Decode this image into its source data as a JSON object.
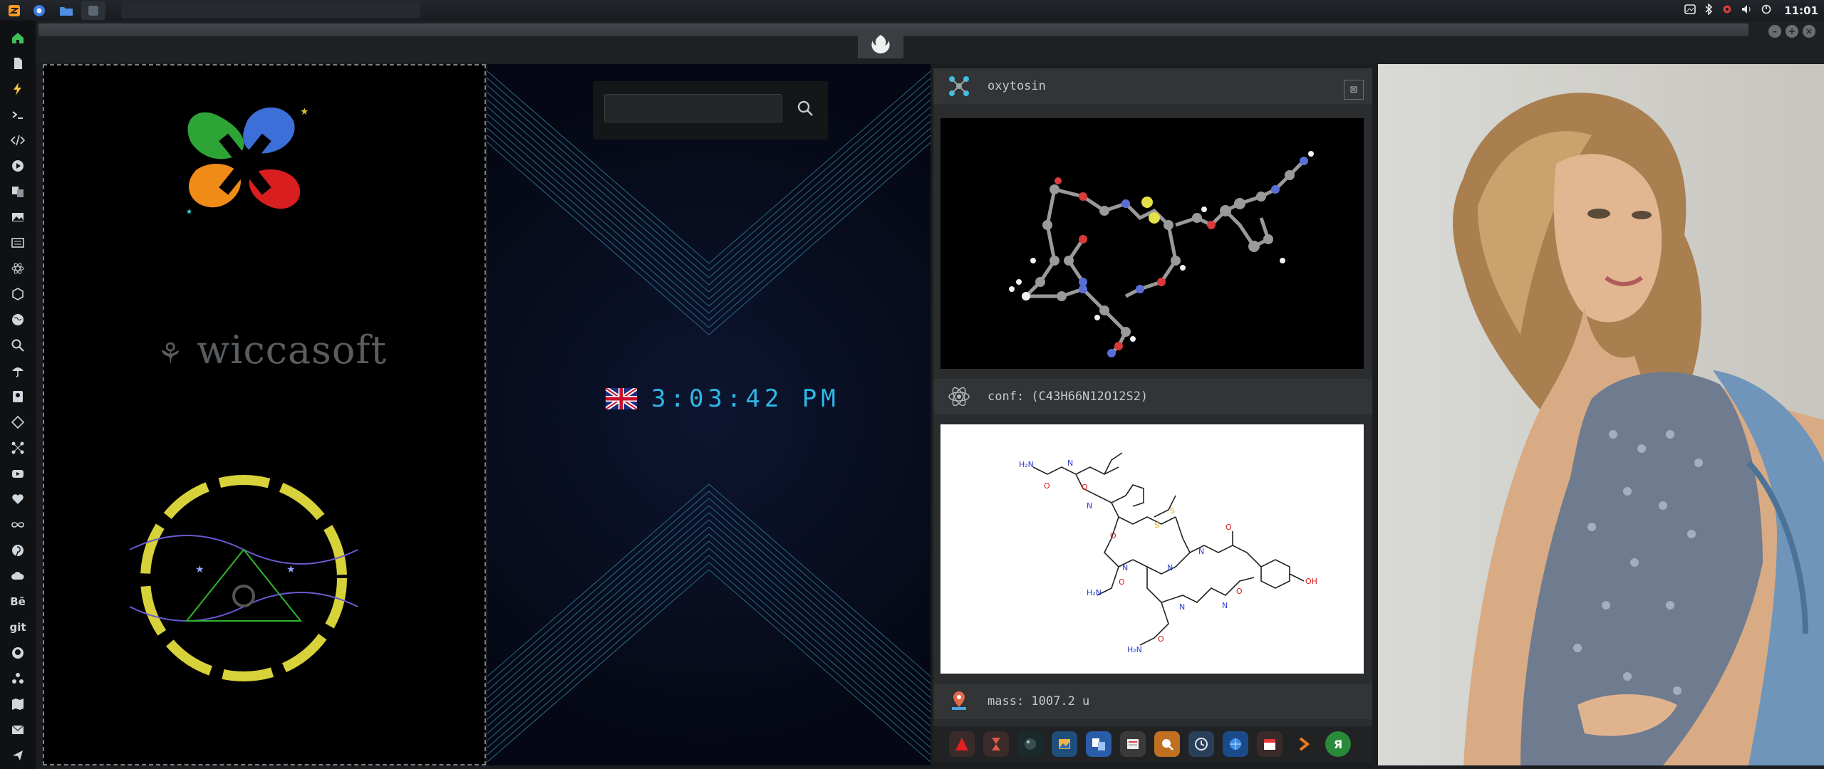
{
  "topbar": {
    "clock": "11:01",
    "tray_icons": [
      "image-icon",
      "bluetooth-icon",
      "gear-icon",
      "volume-icon",
      "power-icon"
    ]
  },
  "dock": {
    "icons": [
      "home-icon",
      "document-icon",
      "lightning-icon",
      "terminal-icon",
      "code-icon",
      "play-icon",
      "translate-icon",
      "image-icon",
      "news-icon",
      "react-icon",
      "hexagon-icon",
      "globe-icon",
      "search-icon",
      "umbrella-icon",
      "contacts-icon",
      "tag-icon",
      "network-icon",
      "youtube-icon",
      "heart-icon",
      "infinity-icon",
      "pinterest-icon",
      "cloud-icon",
      "behance-icon",
      "git-icon",
      "github-icon",
      "puzzle-icon",
      "map-icon",
      "mail-icon",
      "share-icon"
    ],
    "behance_label": "Bē",
    "git_label": "git"
  },
  "panel1": {
    "brand": "wiccasoft"
  },
  "panel2": {
    "search": {
      "placeholder": "",
      "value": ""
    },
    "time": "3:03:42 PM"
  },
  "panel3": {
    "molecule_name": "oxytosin",
    "conformation": "conf: (C43H66N12O12S2)",
    "mass": "mass: 1007.2 u",
    "colors": {
      "carbon": "#9a9a9a",
      "oxygen": "#d93a3a",
      "nitrogen": "#5a6fd6",
      "sulfur": "#e6e04a",
      "hydrogen": "#f2f2f2"
    }
  },
  "bottom_dock": {
    "icons": [
      "adobe-icon",
      "hourglass-icon",
      "planet-icon",
      "photos-icon",
      "translate-icon",
      "news-icon",
      "search-icon",
      "clock-icon",
      "globe-icon",
      "calendar-icon",
      "chevron-right-icon",
      "yandex-icon"
    ]
  },
  "panel4": {
    "image": "portrait-photo"
  }
}
